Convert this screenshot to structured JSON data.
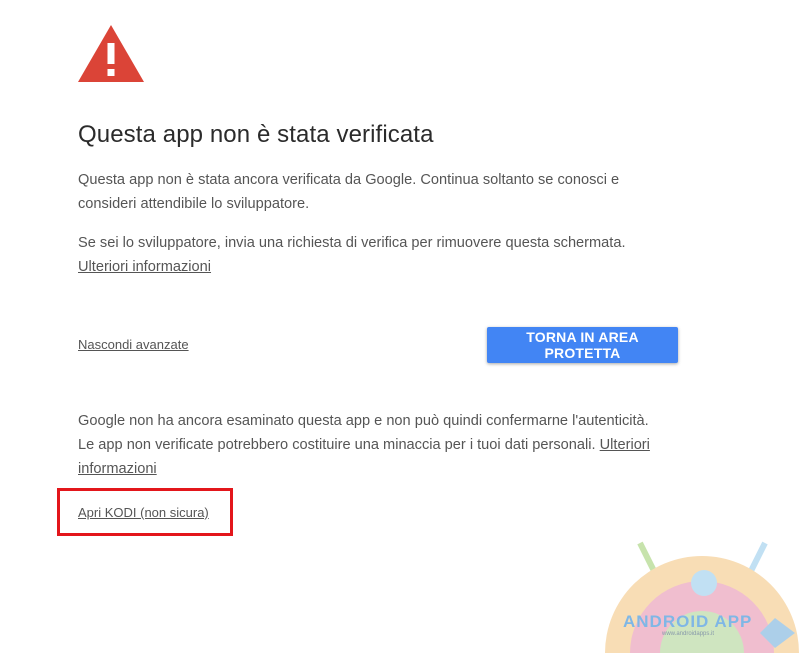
{
  "warning": {
    "icon": "warning-triangle-icon",
    "color": "#db4437"
  },
  "title": "Questa app non è stata verificata",
  "intro": "Questa app non è stata ancora verificata da Google. Continua soltanto se conosci e consideri attendibile lo sviluppatore.",
  "developer_note": {
    "text": "Se sei lo sviluppatore, invia una richiesta di verifica per rimuovere questa schermata.",
    "link": "Ulteriori informazioni"
  },
  "advanced": {
    "hide_label": "Nascondi avanzate",
    "back_button": "TORNA IN AREA PROTETTA",
    "details_line1": "Google non ha ancora esaminato questa app e non può quindi confermarne l'autenticità.",
    "details_line2": "Le app non verificate potrebbero costituire una minaccia per i tuoi dati personali.",
    "details_link": "Ulteriori informazioni",
    "open_link": "Apri KODI (non sicura)"
  },
  "colors": {
    "accent": "#4285f4",
    "highlight": "#e3161b"
  },
  "watermark": {
    "text": "ANDROID APP",
    "url": "www.androidapps.it"
  }
}
